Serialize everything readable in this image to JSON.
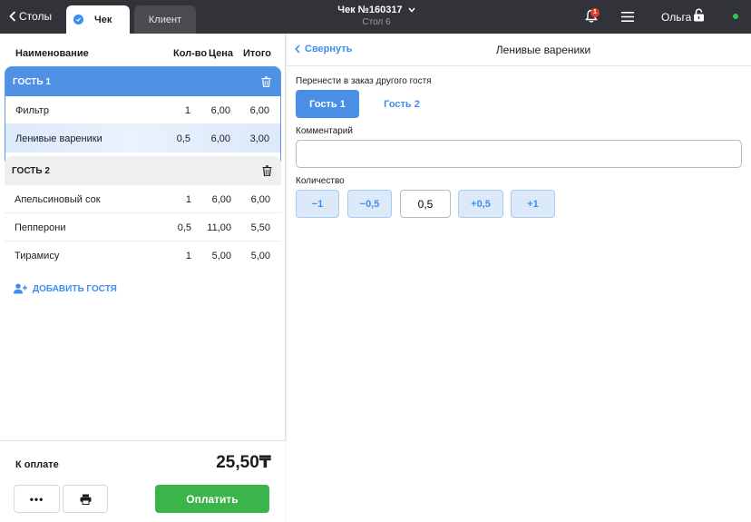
{
  "topbar": {
    "back_label": "Столы",
    "tabs": [
      {
        "label": "Чек",
        "active": true
      },
      {
        "label": "Клиент",
        "active": false
      }
    ],
    "order_title": "Чек №160317",
    "order_subtitle": "Стол 6",
    "notification_count": "1",
    "user_name": "Ольга",
    "status_color": "#3ac04b"
  },
  "order_table": {
    "headers": {
      "name": "Наименование",
      "qty": "Кол-во",
      "price": "Цена",
      "total": "Итого"
    },
    "guests": [
      {
        "label": "ГОСТЬ 1",
        "items": [
          {
            "name": "Фильтр",
            "qty": "1",
            "price": "6,00",
            "total": "6,00"
          },
          {
            "name": "Ленивые вареники",
            "qty": "0,5",
            "price": "6,00",
            "total": "3,00",
            "selected": true
          }
        ]
      },
      {
        "label": "ГОСТЬ 2",
        "items": [
          {
            "name": "Апельсиновый сок",
            "qty": "1",
            "price": "6,00",
            "total": "6,00"
          },
          {
            "name": "Пепперони",
            "qty": "0,5",
            "price": "11,00",
            "total": "5,50"
          },
          {
            "name": "Тирамису",
            "qty": "1",
            "price": "5,00",
            "total": "5,00"
          }
        ]
      }
    ],
    "add_guest_label": "ДОБАВИТЬ ГОСТЯ"
  },
  "footer": {
    "pay_label": "К оплате",
    "pay_sum": "25,50₸",
    "more_label": "•••",
    "pay_button": "Оплатить"
  },
  "detail": {
    "collapse_label": "Свернуть",
    "title": "Ленивые вареники",
    "transfer_label": "Перенести в заказ другого гостя",
    "guest_buttons": [
      "Гость 1",
      "Гость 2"
    ],
    "comment_label": "Комментарий",
    "comment_value": "",
    "quantity_label": "Количество",
    "quantity_buttons": [
      "−1",
      "−0,5",
      "+0,5",
      "+1"
    ],
    "quantity_value": "0,5"
  },
  "colors": {
    "topbar": "#323338",
    "accent": "#3d8ef0",
    "guest_header": "#4f91e4",
    "pay_button": "#3bb54a"
  }
}
